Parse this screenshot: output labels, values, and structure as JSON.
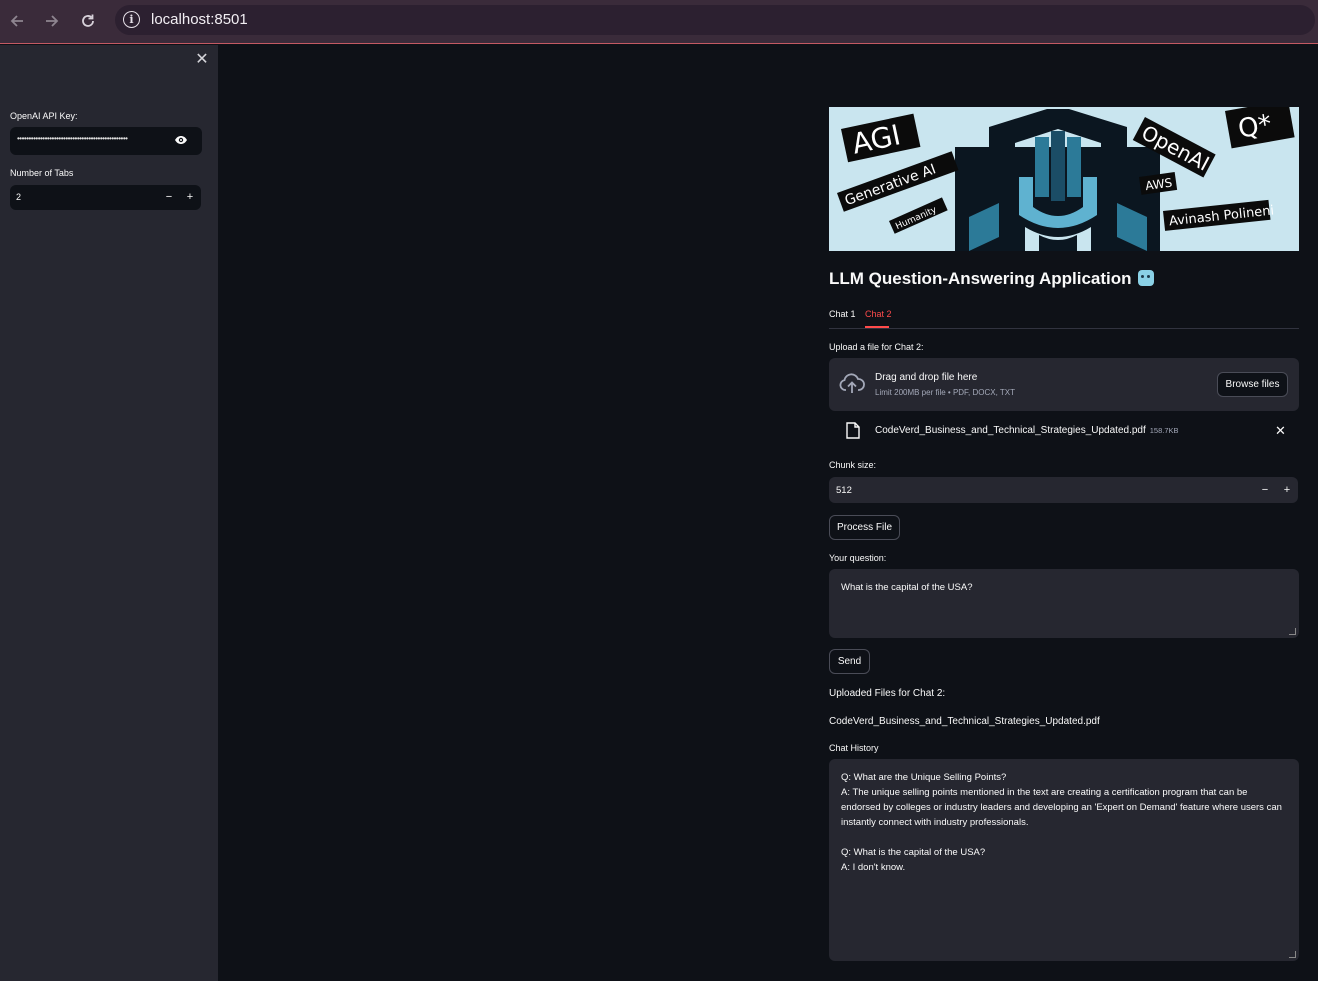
{
  "browser": {
    "url": "localhost:8501"
  },
  "sidebar": {
    "close_glyph": "✕",
    "api_key_label": "OpenAI API Key:",
    "api_key_value": "••••••••••••••••••••••••••••••••••••••••••••••••",
    "num_tabs_label": "Number of Tabs",
    "num_tabs_value": "2",
    "minus": "−",
    "plus": "+"
  },
  "banner": {
    "words": [
      "AGI",
      "Generative AI",
      "Humanity",
      "OpenAI",
      "Q*",
      "AWS",
      "Avinash Polineni"
    ]
  },
  "main": {
    "title": "LLM Question-Answering Application",
    "tabs": [
      {
        "label": "Chat 1",
        "active": false
      },
      {
        "label": "Chat 2",
        "active": true
      }
    ],
    "upload_label": "Upload a file for Chat 2:",
    "drop_text": "Drag and drop file here",
    "limit_text": "Limit 200MB per file • PDF, DOCX, TXT",
    "browse_label": "Browse files",
    "file_name": "CodeVerd_Business_and_Technical_Strategies_Updated.pdf",
    "file_size": "158.7KB",
    "chunk_label": "Chunk size:",
    "chunk_value": "512",
    "process_label": "Process File",
    "question_label": "Your question:",
    "question_value": "What is the capital of the USA?",
    "send_label": "Send",
    "uploaded_heading": "Uploaded Files for Chat 2:",
    "uploaded_file": "CodeVerd_Business_and_Technical_Strategies_Updated.pdf",
    "history_label": "Chat History",
    "history_text": "Q: What are the Unique Selling Points?\nA: The unique selling points mentioned in the text are creating a certification program that can be endorsed by colleges or industry leaders and developing an 'Expert on Demand' feature where users can instantly connect with industry professionals.\n\nQ: What is the capital of the USA?\nA: I don't know."
  },
  "colors": {
    "accent": "#ff4b4b",
    "background": "#0e1117",
    "panel": "#262730"
  }
}
